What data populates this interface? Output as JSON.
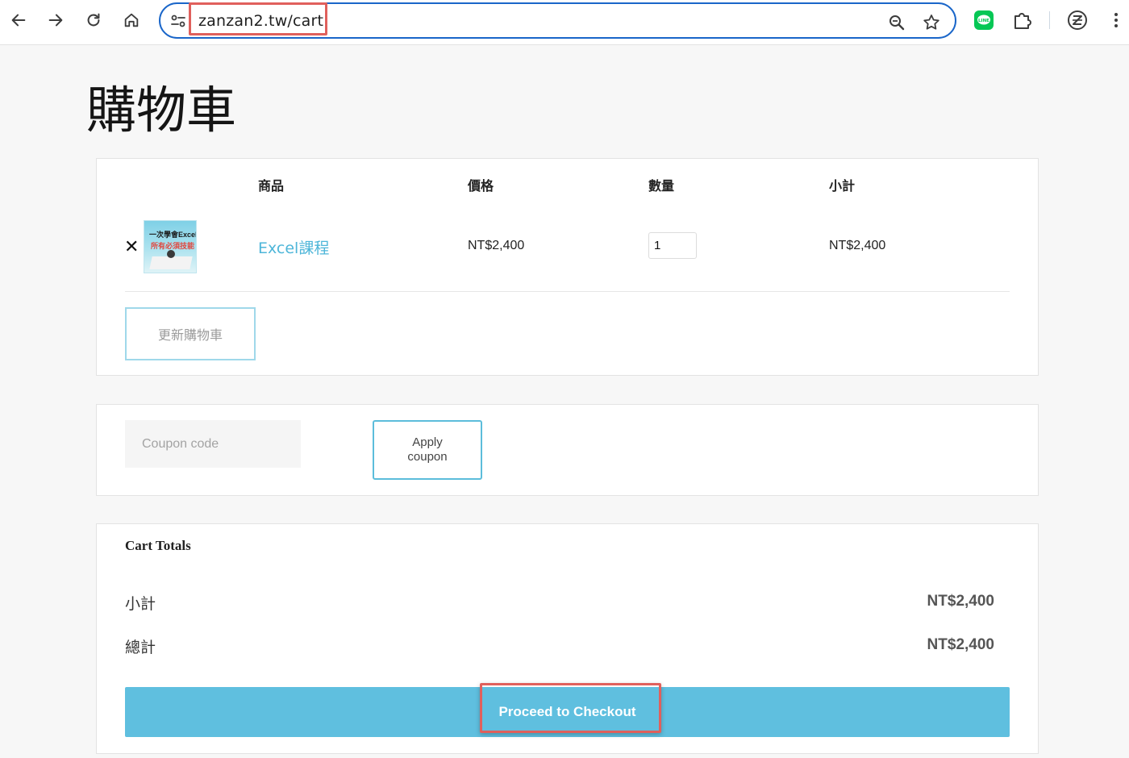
{
  "browser": {
    "url": "zanzan2.tw/cart"
  },
  "page": {
    "title": "購物車"
  },
  "cart": {
    "headers": {
      "product": "商品",
      "price": "價格",
      "quantity": "數量",
      "subtotal": "小計"
    },
    "items": [
      {
        "remove": "✕",
        "thumbnail_text_1": "一次學會Excel",
        "thumbnail_text_2": "所有必須技能",
        "name": "Excel課程",
        "price": "NT$2,400",
        "quantity": "1",
        "subtotal": "NT$2,400"
      }
    ],
    "update_label": "更新購物車"
  },
  "coupon": {
    "placeholder": "Coupon code",
    "apply_label": "Apply coupon"
  },
  "totals": {
    "title": "Cart Totals",
    "subtotal_label": "小計",
    "subtotal_value": "NT$2,400",
    "total_label": "總計",
    "total_value": "NT$2,400",
    "checkout_label": "Proceed to Checkout"
  },
  "colors": {
    "accent": "#5fbfdf",
    "link": "#4eb6d9",
    "highlight": "#e0605c",
    "omnibox_border": "#1a66c9"
  },
  "icons": [
    "back-icon",
    "forward-icon",
    "reload-icon",
    "home-icon",
    "site-info-icon",
    "zoom-icon",
    "bookmark-star-icon",
    "line-extension-icon",
    "extensions-puzzle-icon",
    "profile-z-icon",
    "kebab-menu-icon"
  ]
}
